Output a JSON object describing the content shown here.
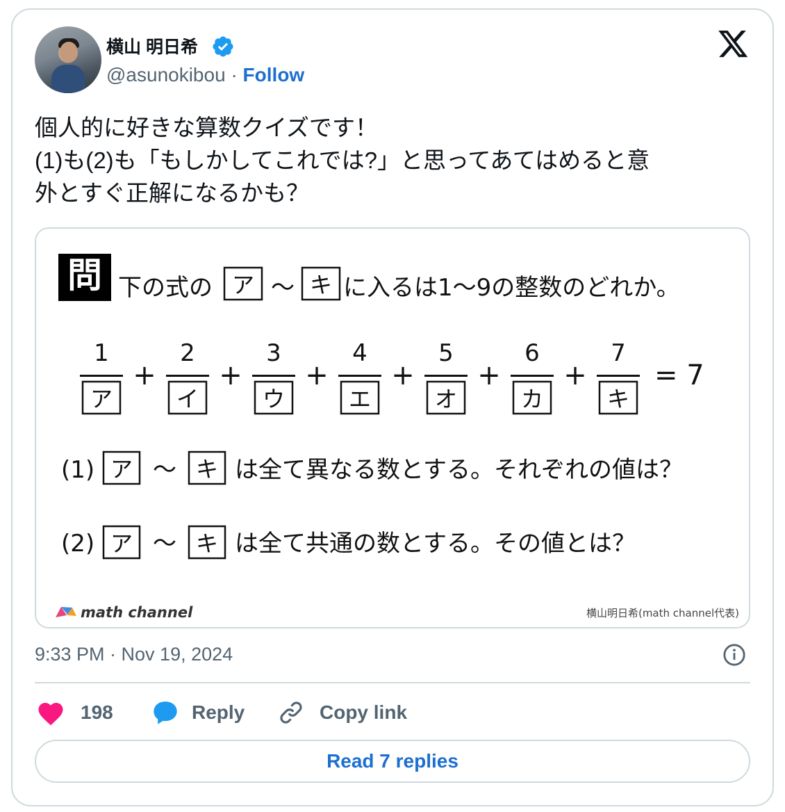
{
  "user": {
    "display_name": "横山 明日希",
    "handle": "@asunokibou",
    "separator": "·",
    "follow_label": "Follow"
  },
  "tweet": {
    "lines": [
      "個人的に好きな算数クイズです！",
      "(1)も(2)も「もしかしてこれでは?」と思ってあてはめると意",
      "外とすぐ正解になるかも？"
    ],
    "timestamp": "9:33 PM · Nov 19, 2024"
  },
  "media": {
    "problem_mark": "問",
    "instruction_pre": "下の式の",
    "instruction_mid": "～",
    "instruction_post": "に入るは1～9の整数のどれか。",
    "first_box": "ア",
    "last_box": "キ",
    "numerators": [
      "1",
      "2",
      "3",
      "4",
      "5",
      "6",
      "7"
    ],
    "denominators": [
      "ア",
      "イ",
      "ウ",
      "エ",
      "オ",
      "カ",
      "キ"
    ],
    "plus": "+",
    "equals": "= 7",
    "q1_label": "(1)",
    "q1_text": "は全て異なる数とする。それぞれの値は？",
    "q2_label": "(2)",
    "q2_text": "は全て共通の数とする。その値とは？",
    "tilde": "～",
    "brand": "math channel",
    "credit": "横山明日希(math channel代表)"
  },
  "actions": {
    "likes": "198",
    "reply_label": "Reply",
    "copy_label": "Copy link",
    "read_replies_label": "Read 7 replies"
  },
  "colors": {
    "accent": "#1d6fd0",
    "verified": "#1d9bf0",
    "like": "#f91880",
    "reply_bubble": "#1d9bf0",
    "muted": "#536471",
    "border": "#cfd9de"
  }
}
